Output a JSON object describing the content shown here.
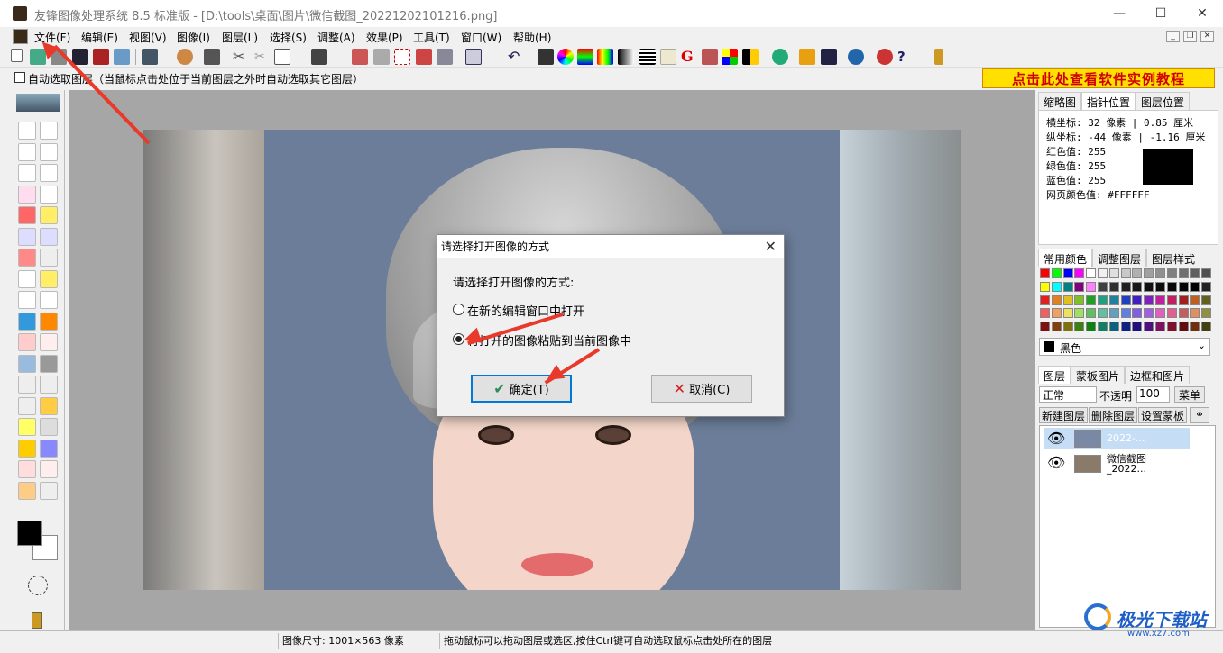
{
  "window": {
    "title": "友锋图像处理系统 8.5 标准版 - [D:\\tools\\桌面\\图片\\微信截图_20221202101216.png]",
    "min": "—",
    "max": "☐",
    "close": "✕"
  },
  "menu": [
    "文件(F)",
    "编辑(E)",
    "视图(V)",
    "图像(I)",
    "图层(L)",
    "选择(S)",
    "调整(A)",
    "效果(P)",
    "工具(T)",
    "窗口(W)",
    "帮助(H)"
  ],
  "options": {
    "auto_select_label": "自动选取图层（当鼠标点击处位于当前图层之外时自动选取其它图层）",
    "banner": "点击此处查看软件实例教程"
  },
  "right_panel": {
    "top_tabs": [
      "缩略图",
      "指针位置",
      "图层位置"
    ],
    "pointer_info": [
      "横坐标: 32 像素 | 0.85 厘米",
      "纵坐标: -44 像素 | -1.16 厘米",
      "红色值: 255",
      "绿色值: 255",
      "蓝色值: 255",
      "网页颜色值: #FFFFFF"
    ],
    "color_tabs": [
      "常用颜色",
      "调整图层",
      "图层样式"
    ],
    "selected_color": "黑色",
    "layer_tabs": [
      "图层",
      "蒙板图片",
      "边框和图片"
    ],
    "blend_mode": "正常",
    "opacity_label": "不透明",
    "opacity_value": "100",
    "menu_button": "菜单",
    "layer_buttons": [
      "新建图层",
      "删除图层",
      "设置蒙板"
    ],
    "layers": [
      {
        "name": "2022-..."
      },
      {
        "name": "微信截图",
        "name2": "_2022..."
      }
    ]
  },
  "dialog": {
    "title": "请选择打开图像的方式",
    "prompt": "请选择打开图像的方式:",
    "option1": "在新的编辑窗口中打开",
    "option2": "将打开的图像粘贴到当前图像中",
    "selected": 2,
    "ok": "确定(T)",
    "cancel": "取消(C)"
  },
  "status": {
    "size": "图像尺寸: 1001×563 像素",
    "hint": "拖动鼠标可以拖动图层或选区,按住Ctrl键可自动选取鼠标点击处所在的图层"
  },
  "watermark": {
    "text1": "极光下载站",
    "text2": "www.xz7.com"
  },
  "colors": {
    "accent_red": "#e8392a",
    "banner_bg": "#ffe000",
    "banner_text": "#d00000",
    "canvas_bg": "#6b7d98"
  }
}
